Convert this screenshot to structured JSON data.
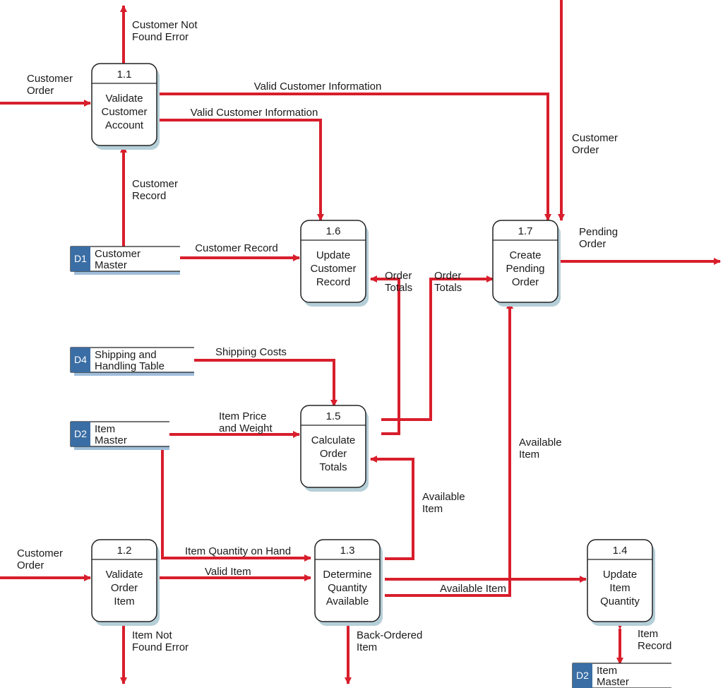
{
  "diagram_type": "Data Flow Diagram (Level 1)",
  "colors": {
    "flow": "#d81e2c",
    "datastore_tab": "#3a6ea5",
    "datastore_shadow": "#9fbedb",
    "process_shadow": "#b5cfd8"
  },
  "processes": {
    "p11": {
      "num": "1.1",
      "l1": "Validate",
      "l2": "Customer",
      "l3": "Account"
    },
    "p12": {
      "num": "1.2",
      "l1": "Validate",
      "l2": "Order",
      "l3": "Item"
    },
    "p13": {
      "num": "1.3",
      "l1": "Determine",
      "l2": "Quantity",
      "l3": "Available"
    },
    "p14": {
      "num": "1.4",
      "l1": "Update",
      "l2": "Item",
      "l3": "Quantity"
    },
    "p15": {
      "num": "1.5",
      "l1": "Calculate",
      "l2": "Order",
      "l3": "Totals"
    },
    "p16": {
      "num": "1.6",
      "l1": "Update",
      "l2": "Customer",
      "l3": "Record"
    },
    "p17": {
      "num": "1.7",
      "l1": "Create",
      "l2": "Pending",
      "l3": "Order"
    }
  },
  "datastores": {
    "d1": {
      "num": "D1",
      "l1": "Customer",
      "l2": "Master"
    },
    "d4": {
      "num": "D4",
      "l1": "Shipping and",
      "l2": "Handling Table"
    },
    "d2a": {
      "num": "D2",
      "l1": "Item",
      "l2": "Master"
    },
    "d2b": {
      "num": "D2",
      "l1": "Item",
      "l2": "Master"
    }
  },
  "flows": {
    "custOrderIn11a": "Customer",
    "custOrderIn11b": "Order",
    "custNotFound1": "Customer Not",
    "custNotFound2": "Found Error",
    "validCustInfoTop": "Valid Customer Information",
    "validCustInfoMid": "Valid Customer Information",
    "custRecord1a": "Customer",
    "custRecord1b": "Record",
    "custRecord2": "Customer Record",
    "custOrderIn17a": "Customer",
    "custOrderIn17b": "Order",
    "pendingOrder1": "Pending",
    "pendingOrder2": "Order",
    "orderTotalsL1": "Order",
    "orderTotalsL2": "Totals",
    "orderTotalsR1": "Order",
    "orderTotalsR2": "Totals",
    "shippingCosts": "Shipping Costs",
    "itemPrice1": "Item Price",
    "itemPrice2": "and Weight",
    "availableItemV1": "Available",
    "availableItemV2": "Item",
    "availableItemR1": "Available",
    "availableItemR2": "Item",
    "availableItemH": "Available Item",
    "custOrderIn12a": "Customer",
    "custOrderIn12b": "Order",
    "itemQtyOnHand": "Item Quantity on Hand",
    "validItem": "Valid Item",
    "itemNotFound1": "Item Not",
    "itemNotFound2": "Found Error",
    "backOrdered1": "Back-Ordered",
    "backOrdered2": "Item",
    "itemRecord1": "Item",
    "itemRecord2": "Record"
  }
}
